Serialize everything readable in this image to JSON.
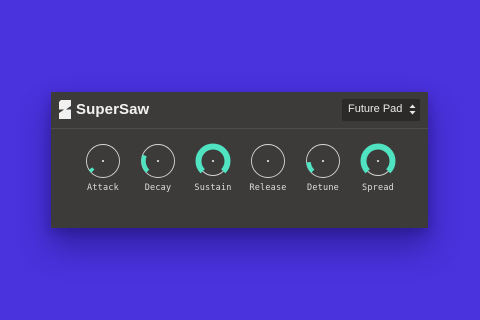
{
  "synth": {
    "title": "SuperSaw",
    "logo_icon": "s-logo-icon",
    "preset": {
      "selected": "Future Pad",
      "icon": "chevron-up-down-icon"
    }
  },
  "colors": {
    "background": "#4a32dc",
    "panel": "#3c3b39",
    "accent": "#50e3c2",
    "track": "#d6d6d6",
    "text": "#f1f1f1"
  },
  "knobs": [
    {
      "label": "Attack",
      "value": 0.05
    },
    {
      "label": "Decay",
      "value": 0.25
    },
    {
      "label": "Sustain",
      "value": 1.0
    },
    {
      "label": "Release",
      "value": 0.0
    },
    {
      "label": "Detune",
      "value": 0.15
    },
    {
      "label": "Spread",
      "value": 1.0
    }
  ]
}
